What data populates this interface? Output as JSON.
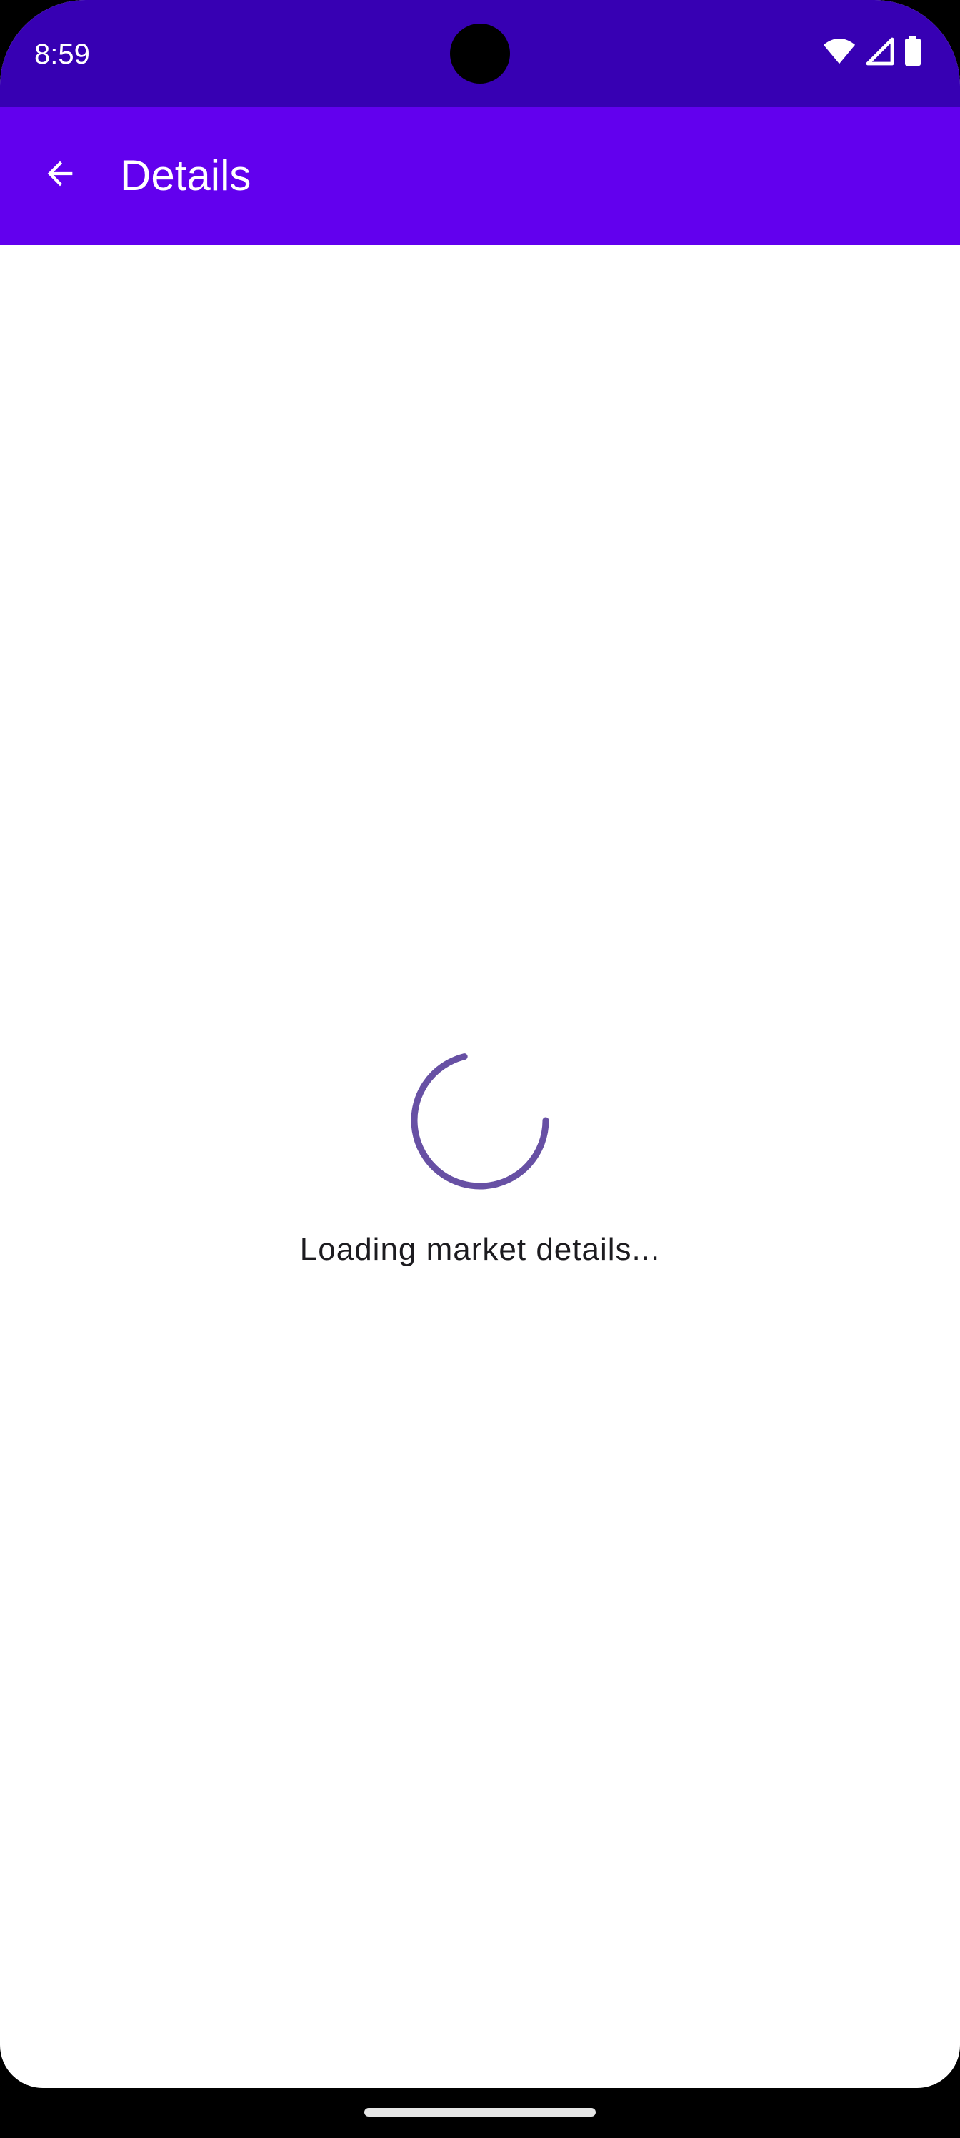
{
  "status_bar": {
    "time": "8:59",
    "icons": [
      "wifi-icon",
      "cellular-signal-icon",
      "battery-icon"
    ]
  },
  "app_bar": {
    "title": "Details",
    "back_icon": "arrow-back-icon"
  },
  "content": {
    "loading_text": "Loading market details...",
    "spinner_icon": "progress-spinner"
  },
  "colors": {
    "status_bar": "#3700b3",
    "app_bar": "#6200ee",
    "spinner": "#6750a4",
    "background": "#ffffff",
    "text": "#1c1b1f"
  }
}
